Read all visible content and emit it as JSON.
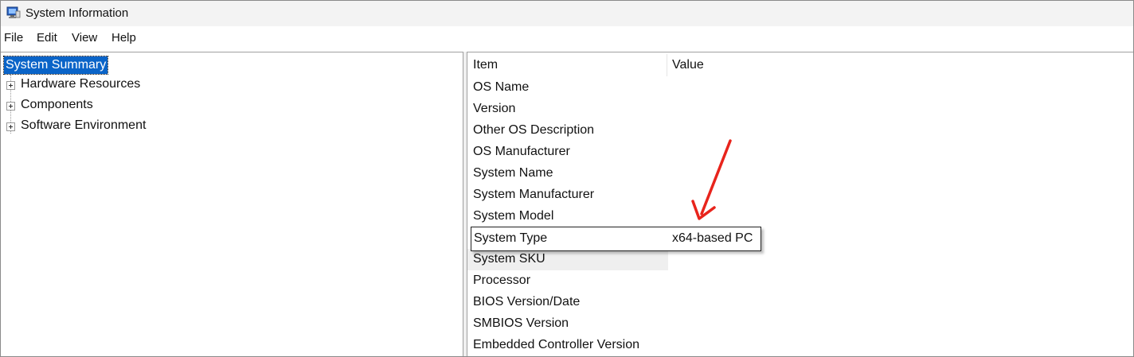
{
  "window": {
    "title": "System Information",
    "icon": "system-information-app-icon"
  },
  "menu": [
    "File",
    "Edit",
    "View",
    "Help"
  ],
  "tree": {
    "root": "System Summary",
    "children": [
      "Hardware Resources",
      "Components",
      "Software Environment"
    ]
  },
  "table": {
    "columns": [
      "Item",
      "Value"
    ],
    "rows": [
      {
        "item": "OS Name",
        "value": ""
      },
      {
        "item": "Version",
        "value": ""
      },
      {
        "item": "Other OS Description",
        "value": ""
      },
      {
        "item": "OS Manufacturer",
        "value": ""
      },
      {
        "item": "System Name",
        "value": ""
      },
      {
        "item": "System Manufacturer",
        "value": ""
      },
      {
        "item": "System Model",
        "value": ""
      },
      {
        "item": "System Type",
        "value": "x64-based PC"
      },
      {
        "item": "System SKU",
        "value": ""
      },
      {
        "item": "Processor",
        "value": ""
      },
      {
        "item": "BIOS Version/Date",
        "value": ""
      },
      {
        "item": "SMBIOS Version",
        "value": ""
      },
      {
        "item": "Embedded Controller Version",
        "value": ""
      }
    ]
  },
  "annotation": {
    "arrow_color": "#e8241c"
  },
  "colors": {
    "selection": "#0a64c8",
    "titlebar": "#f3f3f3"
  }
}
